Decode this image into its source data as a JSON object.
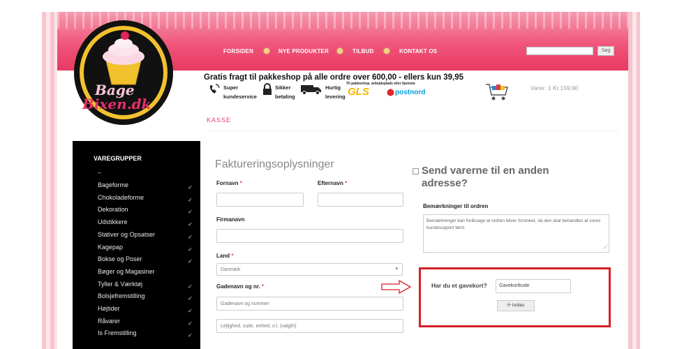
{
  "nav": {
    "items": [
      "FORSIDEN",
      "NYE PRODUKTER",
      "TILBUD",
      "KONTAKT OS"
    ],
    "search_placeholder": "",
    "search_button": "Søg"
  },
  "logo": {
    "text_line1": "Bage",
    "text_line2": "Bixen.dk"
  },
  "shipping_banner": "Gratis fragt til pakkeshop på alle ordre over 600,00 - ellers kun 39,95",
  "features": [
    {
      "icon": "phone-icon",
      "line1": "Super",
      "line2": "kundeservice"
    },
    {
      "icon": "lock-icon",
      "line1": "Sikker",
      "line2": "betaling"
    },
    {
      "icon": "truck-icon",
      "line1": "Hurtig",
      "line2": "levering"
    }
  ],
  "carriers": {
    "note": "Til pakkeshop, arbejdsplads eller hjemme",
    "gls": "GLS",
    "postnord": "postnord"
  },
  "cart": {
    "summary": "Varer: 1 Kr.159,90"
  },
  "breadcrumb": "KASSE",
  "sidebar": {
    "title": "VAREGRUPPER",
    "dash": "–",
    "items": [
      {
        "label": "Bageforme",
        "check": true
      },
      {
        "label": "Chokoladeforme",
        "check": true
      },
      {
        "label": "Dekoration",
        "check": true
      },
      {
        "label": "Udstikkere",
        "check": true
      },
      {
        "label": "Stativer og Opsatser",
        "check": true
      },
      {
        "label": "Kagepap",
        "check": true
      },
      {
        "label": "Bokse og Poser",
        "check": true
      },
      {
        "label": "Bøger og Magasiner",
        "check": false
      },
      {
        "label": "Tyller & Værktøj",
        "check": true
      },
      {
        "label": "Bolsjefremstilling",
        "check": true
      },
      {
        "label": "Højtider",
        "check": true
      },
      {
        "label": "Råvarer",
        "check": true
      },
      {
        "label": "Is Fremstilling",
        "check": true
      }
    ]
  },
  "billing": {
    "title": "Faktureringsoplysninger",
    "firstname_label": "Fornavn",
    "lastname_label": "Efternavn",
    "company_label": "Firmanavn",
    "country_label": "Land",
    "country_value": "Danmark",
    "street_label": "Gadenavn og nr.",
    "street_placeholder": "Gadenavn og nummer",
    "street2_placeholder": "Lejlighed, suite, enhed, o.l. (valgfri)",
    "required_mark": "*"
  },
  "shipping": {
    "title": "Send varerne til en anden adresse?",
    "notes_label": "Bemærkninger til ordren",
    "notes_placeholder": "Bemærkninger kan forårsage at ordren bliver forsinket, da den skal behandles af vores kundesupport først"
  },
  "gift": {
    "label": "Har du et gavekort?",
    "input_placeholder": "Gavekortkode",
    "button_label": "Indløs",
    "highlight_color": "#d61f26"
  },
  "colors": {
    "header_pink": "#f0557a",
    "accent": "#e2406a"
  }
}
